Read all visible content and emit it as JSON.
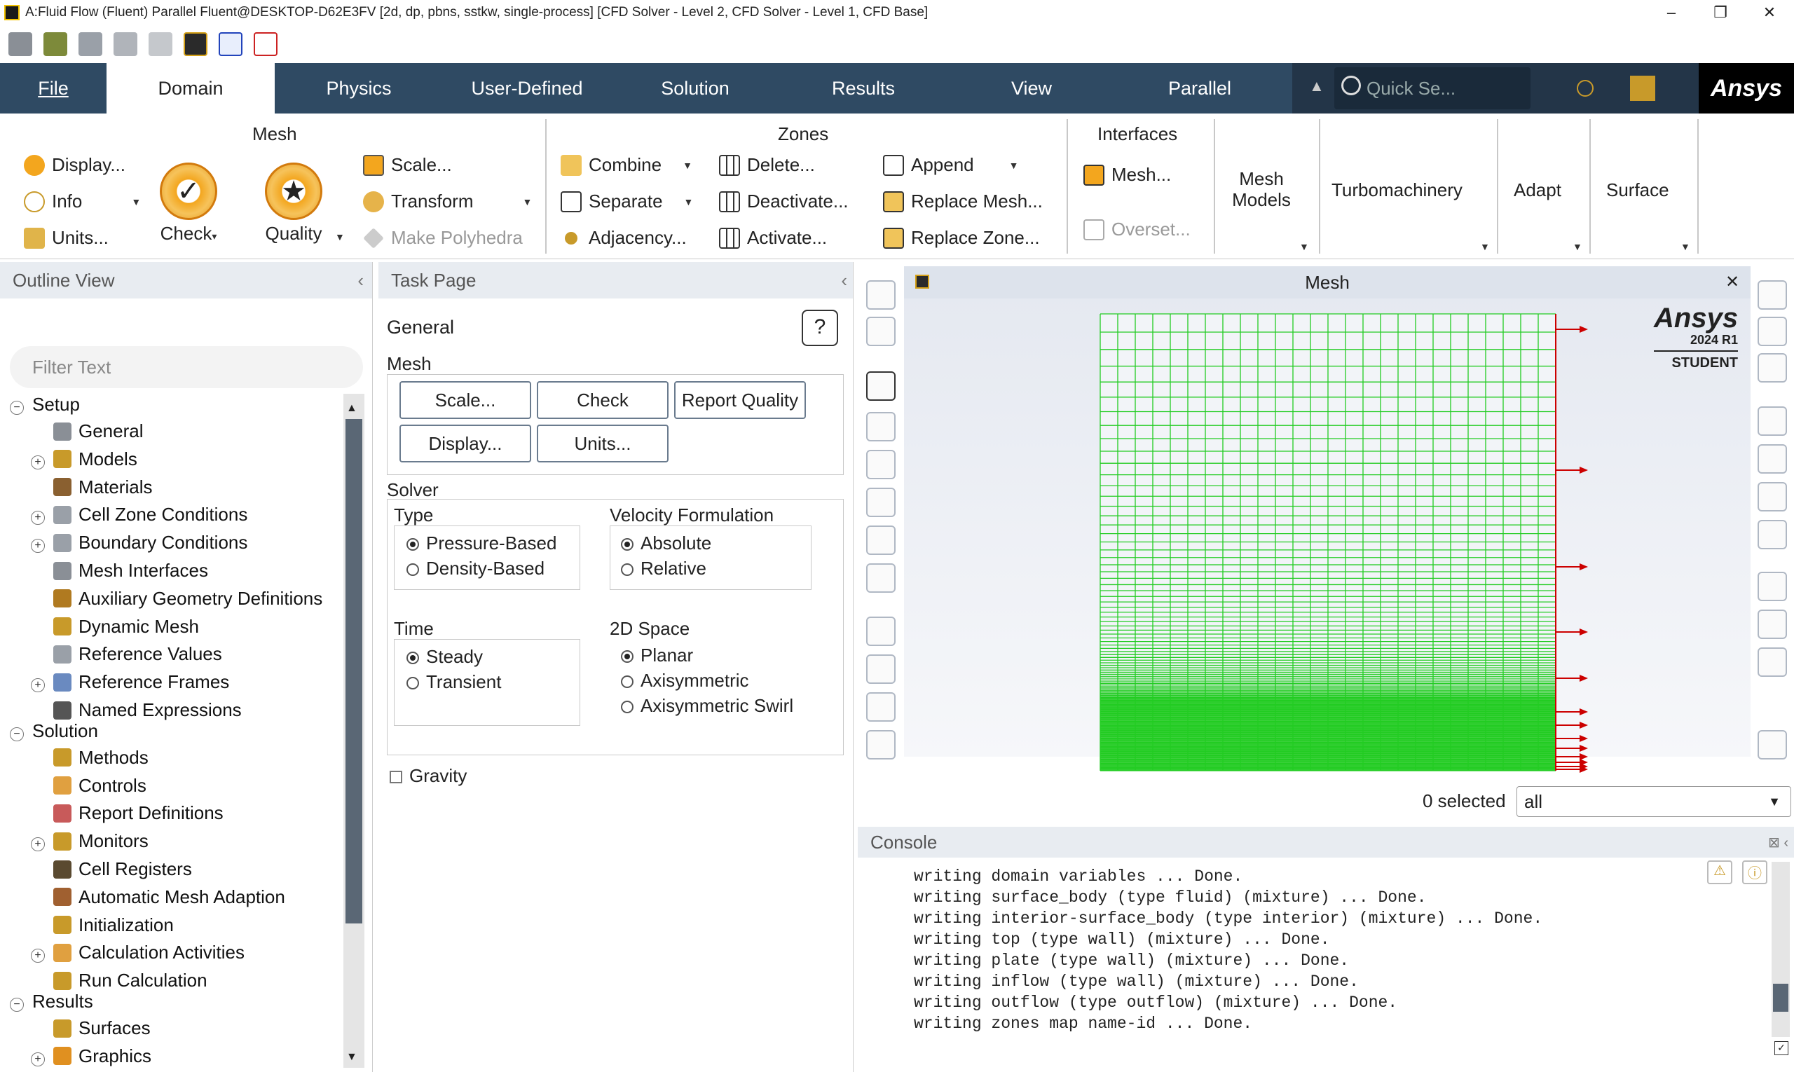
{
  "window": {
    "title": "A:Fluid Flow (Fluent) Parallel Fluent@DESKTOP-D62E3FV  [2d, dp, pbns, sstkw, single-process] [CFD Solver - Level 2, CFD Solver - Level 1, CFD Base]"
  },
  "tabs": [
    "File",
    "Domain",
    "Physics",
    "User-Defined",
    "Solution",
    "Results",
    "View",
    "Parallel"
  ],
  "active_tab": "Domain",
  "quick_search": {
    "placeholder": "Quick Se..."
  },
  "brand": "Ansys",
  "ribbon": {
    "mesh": {
      "title": "Mesh",
      "display": "Display...",
      "info": "Info",
      "units": "Units...",
      "check": "Check",
      "quality": "Quality",
      "scale": "Scale...",
      "transform": "Transform",
      "make_polyhedra": "Make Polyhedra"
    },
    "zones": {
      "title": "Zones",
      "combine": "Combine",
      "separate": "Separate",
      "adjacency": "Adjacency...",
      "delete": "Delete...",
      "deactivate": "Deactivate...",
      "activate": "Activate...",
      "append": "Append",
      "replace_mesh": "Replace Mesh...",
      "replace_zone": "Replace Zone..."
    },
    "interfaces": {
      "title": "Interfaces",
      "mesh": "Mesh...",
      "overset": "Overset..."
    },
    "mesh_models": "Mesh Models",
    "turbomachinery": "Turbomachinery",
    "adapt": "Adapt",
    "surface": "Surface"
  },
  "outline": {
    "title": "Outline View",
    "filter_placeholder": "Filter Text",
    "setup": "Setup",
    "setup_items": [
      "General",
      "Models",
      "Materials",
      "Cell Zone Conditions",
      "Boundary Conditions",
      "Mesh Interfaces",
      "Auxiliary Geometry Definitions",
      "Dynamic Mesh",
      "Reference Values",
      "Reference Frames",
      "Named Expressions"
    ],
    "solution": "Solution",
    "solution_items": [
      "Methods",
      "Controls",
      "Report Definitions",
      "Monitors",
      "Cell Registers",
      "Automatic Mesh Adaption",
      "Initialization",
      "Calculation Activities",
      "Run Calculation"
    ],
    "results": "Results",
    "results_items": [
      "Surfaces",
      "Graphics"
    ]
  },
  "task": {
    "title": "Task Page",
    "heading": "General",
    "mesh_label": "Mesh",
    "btn_scale": "Scale...",
    "btn_check": "Check",
    "btn_report": "Report Quality",
    "btn_display": "Display...",
    "btn_units": "Units...",
    "solver_label": "Solver",
    "type_label": "Type",
    "type_opts": [
      "Pressure-Based",
      "Density-Based"
    ],
    "vel_label": "Velocity Formulation",
    "vel_opts": [
      "Absolute",
      "Relative"
    ],
    "time_label": "Time",
    "time_opts": [
      "Steady",
      "Transient"
    ],
    "space_label": "2D Space",
    "space_opts": [
      "Planar",
      "Axisymmetric",
      "Axisymmetric Swirl"
    ],
    "gravity": "Gravity"
  },
  "graphics": {
    "title": "Mesh",
    "ansys": "Ansys",
    "version": "2024 R1",
    "edition": "STUDENT",
    "selected": "0 selected",
    "select_value": "all"
  },
  "console": {
    "title": "Console",
    "lines": [
      "writing domain variables ... Done.",
      "writing surface_body (type fluid) (mixture) ... Done.",
      "writing interior-surface_body (type interior) (mixture) ... Done.",
      "writing top (type wall) (mixture) ... Done.",
      "writing plate (type wall) (mixture) ... Done.",
      "writing inflow (type wall) (mixture) ... Done.",
      "writing outflow (type outflow) (mixture) ... Done.",
      "writing zones map name-id ... Done."
    ]
  },
  "colors": {
    "tabbar": "#2f4a63",
    "mesh": "#22cc22",
    "arrow": "#cc0000",
    "accent": "#f3a61e"
  }
}
